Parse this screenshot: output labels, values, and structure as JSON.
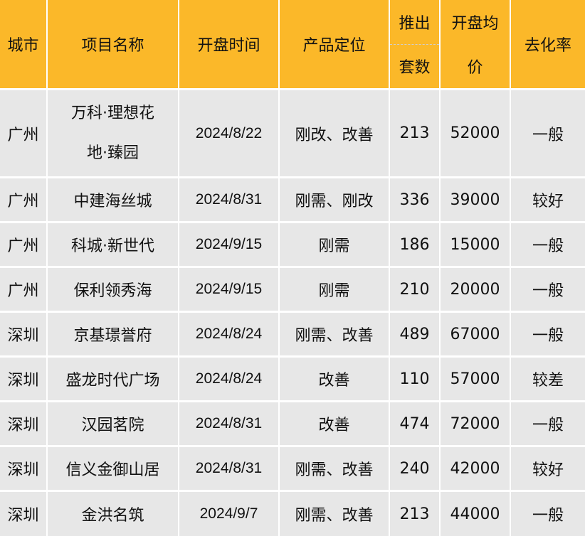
{
  "table": {
    "headers": {
      "city": "城市",
      "project": "项目名称",
      "open_date": "开盘时间",
      "positioning": "产品定位",
      "units_line1": "推出",
      "units_line2": "套数",
      "price_line1": "开盘均",
      "price_line2": "价",
      "absorption": "去化率"
    },
    "rows": [
      {
        "city": "广州",
        "project_line1": "万科·理想花",
        "project_line2": "地·臻园",
        "open_date": "2024/8/22",
        "positioning": "刚改、改善",
        "units": "213",
        "avg_price": "52000",
        "absorption": "一般"
      },
      {
        "city": "广州",
        "project": "中建海丝城",
        "open_date": "2024/8/31",
        "positioning": "刚需、刚改",
        "units": "336",
        "avg_price": "39000",
        "absorption": "较好"
      },
      {
        "city": "广州",
        "project": "科城·新世代",
        "open_date": "2024/9/15",
        "positioning": "刚需",
        "units": "186",
        "avg_price": "15000",
        "absorption": "一般"
      },
      {
        "city": "广州",
        "project": "保利领秀海",
        "open_date": "2024/9/15",
        "positioning": "刚需",
        "units": "210",
        "avg_price": "20000",
        "absorption": "一般"
      },
      {
        "city": "深圳",
        "project": "京基璟誉府",
        "open_date": "2024/8/24",
        "positioning": "刚需、改善",
        "units": "489",
        "avg_price": "67000",
        "absorption": "一般"
      },
      {
        "city": "深圳",
        "project": "盛龙时代广场",
        "open_date": "2024/8/24",
        "positioning": "改善",
        "units": "110",
        "avg_price": "57000",
        "absorption": "较差"
      },
      {
        "city": "深圳",
        "project": "汉园茗院",
        "open_date": "2024/8/31",
        "positioning": "改善",
        "units": "474",
        "avg_price": "72000",
        "absorption": "一般"
      },
      {
        "city": "深圳",
        "project": "信义金御山居",
        "open_date": "2024/8/31",
        "positioning": "刚需、改善",
        "units": "240",
        "avg_price": "42000",
        "absorption": "较好"
      },
      {
        "city": "深圳",
        "project": "金洪名筑",
        "open_date": "2024/9/7",
        "positioning": "刚需、改善",
        "units": "213",
        "avg_price": "44000",
        "absorption": "一般"
      }
    ]
  },
  "colors": {
    "header_bg": "#fbb829",
    "cell_bg": "#e7e7e7",
    "grid": "#ffffff"
  }
}
